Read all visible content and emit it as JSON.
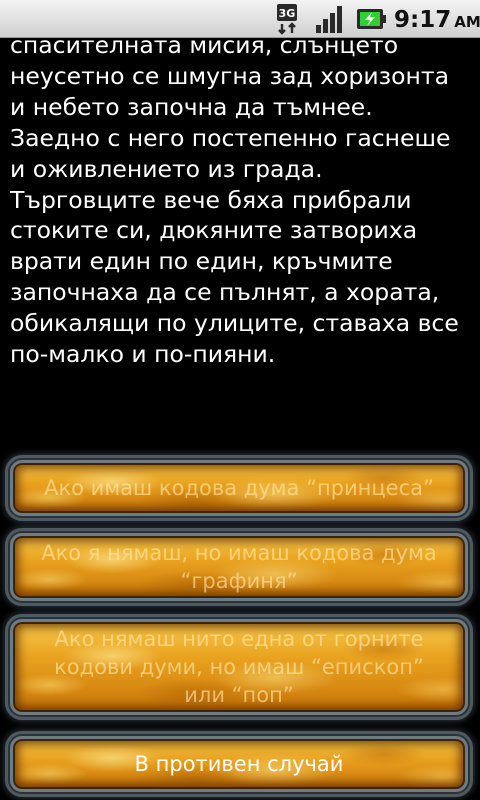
{
  "status_bar": {
    "time": "9:17",
    "ampm": "AM",
    "network_label": "3G",
    "icons": [
      "3g-data-icon",
      "signal-strength-icon",
      "battery-charging-icon"
    ]
  },
  "story": {
    "lines": [
      "спасителната мисия, слънцето",
      "неусетно се шмугна зад хоризонта",
      "и небето започна да тъмнее.",
      "Заедно с него постепенно гаснеше",
      "и оживлението из града.",
      "Търговците вече бяха прибрали",
      "стоките си, дюкяните затвориха",
      "врати един по един, кръчмите",
      "започнаха да се пълнят, а хората,",
      "обикалящи по улиците, ставаха все",
      "по-малко и по-пияни."
    ]
  },
  "choices": [
    {
      "lines": [
        "Ако имаш кодова дума “принцеса”"
      ]
    },
    {
      "lines": [
        "Ако я нямаш, но имаш кодова дума",
        "“графиня”"
      ]
    },
    {
      "lines": [
        "Ако нямаш нито една от горните",
        "кодови думи, но имаш “епископ”",
        "или “поп”"
      ]
    },
    {
      "lines": [
        "В противен случай"
      ]
    }
  ],
  "colors": {
    "background": "#000000",
    "story_text": "#ffffff",
    "button_gold": "#e9a21f",
    "button_frame": "#6f7a82"
  }
}
